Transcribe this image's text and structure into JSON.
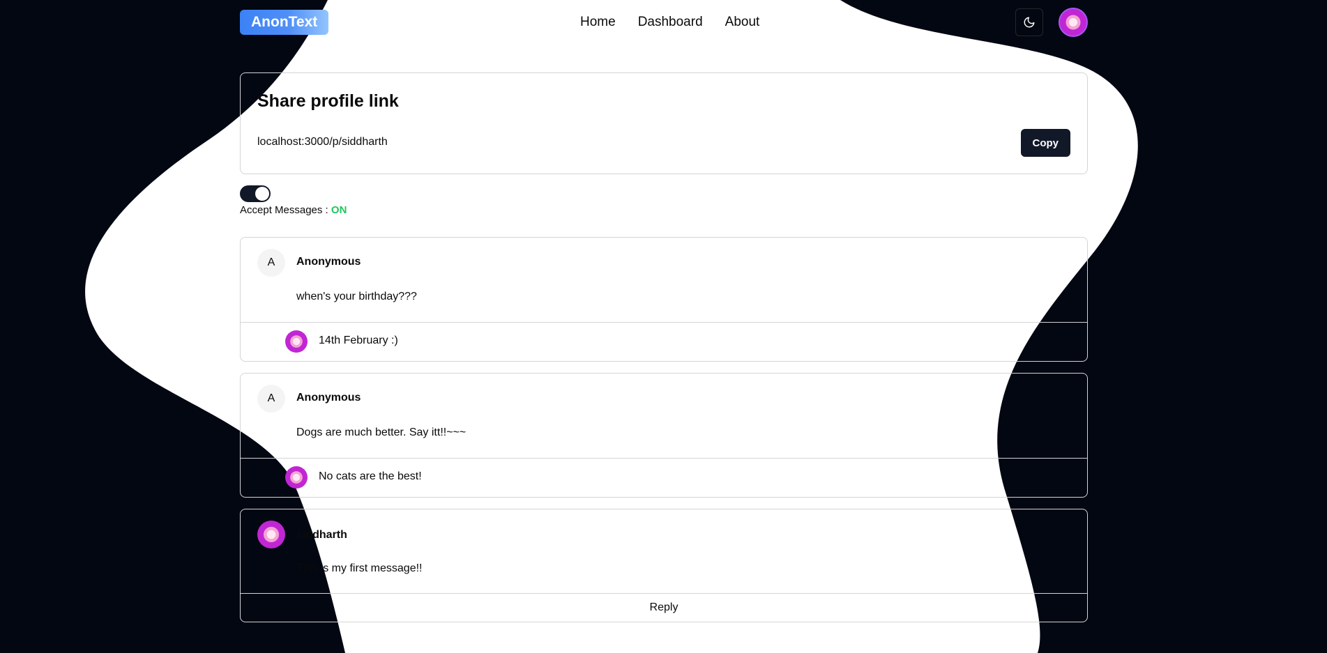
{
  "nav": {
    "logo": "AnonText",
    "links": [
      "Home",
      "Dashboard",
      "About"
    ],
    "theme_icon": "moon-icon",
    "avatar_icon": "donut-avatar"
  },
  "share": {
    "title": "Share profile link",
    "url": "localhost:3000/p/siddharth",
    "copy_label": "Copy"
  },
  "accept": {
    "label": "Accept Messages : ",
    "state": "ON",
    "enabled": true
  },
  "messages": [
    {
      "sender": "Anonymous",
      "avatar_letter": "A",
      "text": "when's your birthday???",
      "reply": "14th February :)"
    },
    {
      "sender": "Anonymous",
      "avatar_letter": "A",
      "text": "Dogs are much better. Say itt!!~~~",
      "reply": "No cats are the best!"
    },
    {
      "sender": "siddharth",
      "text": "This is my first message!!",
      "reply_label": "Reply"
    }
  ],
  "colors": {
    "background": "#030712",
    "blob": "#ffffff",
    "accent": "#3b82f6",
    "on": "#22c55e",
    "button": "#111827"
  }
}
